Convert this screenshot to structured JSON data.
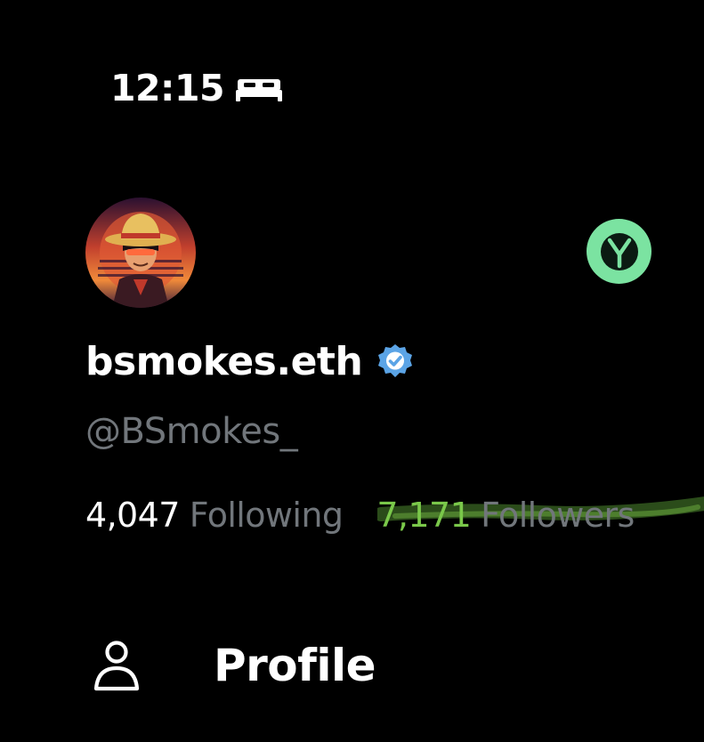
{
  "status_bar": {
    "time": "12:15",
    "focus_icon": "bed-icon"
  },
  "profile": {
    "display_name": "bsmokes.eth",
    "verified_icon": "verified-badge-icon",
    "verified_color": "#1d9bf0",
    "handle": "@BSmokes_",
    "avatar_icon": "avatar-image",
    "app_badge_icon": "y-logo-icon",
    "app_badge_color": "#7be3a1"
  },
  "stats": {
    "following_count": "4,047",
    "following_label": "Following",
    "followers_count": "7,171",
    "followers_label": "Followers"
  },
  "nav": {
    "profile_label": "Profile",
    "profile_icon": "person-icon"
  },
  "colors": {
    "background": "#000000",
    "text_primary": "#ffffff",
    "text_secondary": "#71767b",
    "highlight": "#5fa03a"
  }
}
